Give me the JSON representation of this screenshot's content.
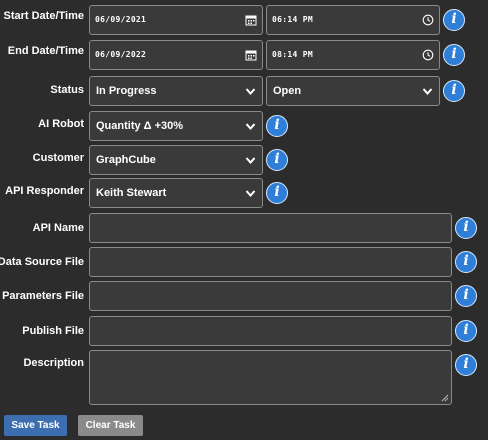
{
  "form": {
    "start": {
      "label": "Start Date/Time",
      "date": "06/09/2021",
      "time": "06:14 PM"
    },
    "end": {
      "label": "End Date/Time",
      "date": "06/09/2022",
      "time": "08:14 PM"
    },
    "status": {
      "label": "Status",
      "value": "In Progress",
      "value2": "Open"
    },
    "ai_robot": {
      "label": "AI Robot",
      "value": "Quantity Δ +30%"
    },
    "customer": {
      "label": "Customer",
      "value": "GraphCube"
    },
    "api_responder": {
      "label": "API Responder",
      "value": "Keith Stewart"
    },
    "api_name": {
      "label": "API Name",
      "value": ""
    },
    "data_source_file": {
      "label": "Data Source File",
      "value": ""
    },
    "parameters_file": {
      "label": "Parameters File",
      "value": ""
    },
    "publish_file": {
      "label": "Publish File",
      "value": ""
    },
    "description": {
      "label": "Description",
      "value": ""
    }
  },
  "buttons": {
    "save": "Save Task",
    "clear": "Clear Task"
  },
  "icons": {
    "info": "i"
  },
  "colors": {
    "background": "#2c2c2c",
    "info_blue": "#2f7fd8",
    "save_button": "#3d6fb0",
    "clear_button": "#8a8a8a"
  }
}
